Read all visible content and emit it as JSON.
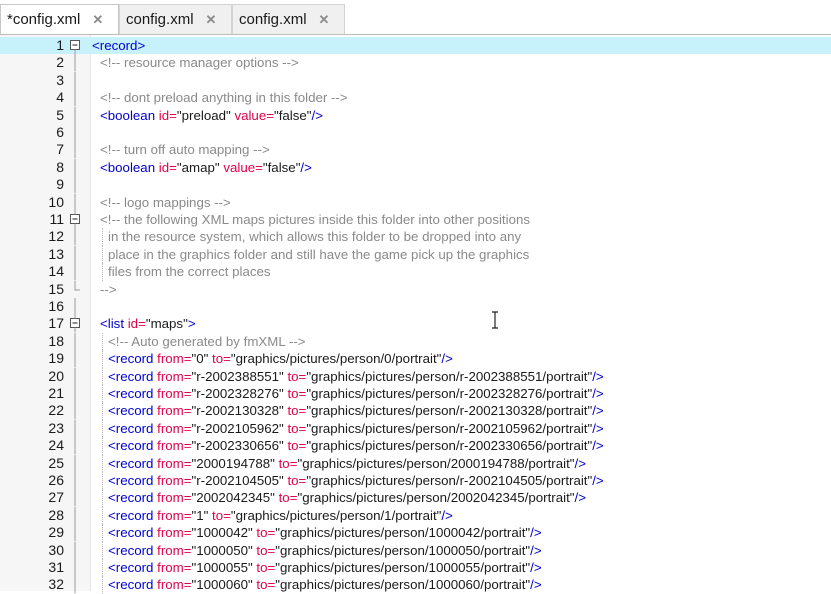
{
  "tabs": [
    {
      "label": "*config.xml",
      "active": true
    },
    {
      "label": "config.xml",
      "active": false
    },
    {
      "label": "config.xml",
      "active": false
    }
  ],
  "editor": {
    "current_line": 1,
    "lines": [
      {
        "n": "1",
        "indent": 0,
        "fold": "box",
        "parts": [
          {
            "t": "<record>",
            "c": "tg"
          }
        ]
      },
      {
        "n": "2",
        "indent": 1,
        "fold": "bar",
        "parts": [
          {
            "t": "<!-- resource manager options -->",
            "c": "cm"
          }
        ]
      },
      {
        "n": "3",
        "indent": 0,
        "fold": "bar",
        "parts": []
      },
      {
        "n": "4",
        "indent": 1,
        "fold": "bar",
        "parts": [
          {
            "t": "<!-- dont preload anything in this folder -->",
            "c": "cm"
          }
        ]
      },
      {
        "n": "5",
        "indent": 1,
        "fold": "bar",
        "parts": [
          {
            "t": "<boolean ",
            "c": "tg"
          },
          {
            "t": "id=",
            "c": "at"
          },
          {
            "t": "\"",
            "c": "tx"
          },
          {
            "t": "preload",
            "c": "tx"
          },
          {
            "t": "\" ",
            "c": "tx"
          },
          {
            "t": "value=",
            "c": "at"
          },
          {
            "t": "\"false\"",
            "c": "tx"
          },
          {
            "t": "/>",
            "c": "tg"
          }
        ]
      },
      {
        "n": "6",
        "indent": 0,
        "fold": "bar",
        "parts": []
      },
      {
        "n": "7",
        "indent": 1,
        "fold": "bar",
        "parts": [
          {
            "t": "<!-- turn off auto mapping -->",
            "c": "cm"
          }
        ]
      },
      {
        "n": "8",
        "indent": 1,
        "fold": "bar",
        "parts": [
          {
            "t": "<boolean ",
            "c": "tg"
          },
          {
            "t": "id=",
            "c": "at"
          },
          {
            "t": "\"amap\" ",
            "c": "tx"
          },
          {
            "t": "value=",
            "c": "at"
          },
          {
            "t": "\"false\"",
            "c": "tx"
          },
          {
            "t": "/>",
            "c": "tg"
          }
        ]
      },
      {
        "n": "9",
        "indent": 0,
        "fold": "bar",
        "parts": []
      },
      {
        "n": "10",
        "indent": 1,
        "fold": "bar",
        "parts": [
          {
            "t": "<!-- logo mappings -->",
            "c": "cm"
          }
        ]
      },
      {
        "n": "11",
        "indent": 1,
        "fold": "box",
        "parts": [
          {
            "t": "<!-- the following XML maps pictures inside this folder into other positions",
            "c": "cm"
          }
        ]
      },
      {
        "n": "12",
        "indent": 2,
        "fold": "bar",
        "parts": [
          {
            "t": "in the resource system, which allows this folder to be dropped into any",
            "c": "cm"
          }
        ]
      },
      {
        "n": "13",
        "indent": 2,
        "fold": "bar",
        "parts": [
          {
            "t": "place in the graphics folder and still have the game pick up the graphics",
            "c": "cm"
          }
        ]
      },
      {
        "n": "14",
        "indent": 2,
        "fold": "bar",
        "parts": [
          {
            "t": "files from the correct places",
            "c": "cm"
          }
        ]
      },
      {
        "n": "15",
        "indent": 1,
        "fold": "end",
        "parts": [
          {
            "t": "-->",
            "c": "cm"
          }
        ]
      },
      {
        "n": "16",
        "indent": 0,
        "fold": "bar",
        "parts": []
      },
      {
        "n": "17",
        "indent": 1,
        "fold": "box",
        "parts": [
          {
            "t": "<list ",
            "c": "tg"
          },
          {
            "t": "id=",
            "c": "at"
          },
          {
            "t": "\"maps\"",
            "c": "tx"
          },
          {
            "t": ">",
            "c": "tg"
          }
        ]
      },
      {
        "n": "18",
        "indent": 2,
        "fold": "bar",
        "parts": [
          {
            "t": "<!-- Auto generated by fmXML -->",
            "c": "cm"
          }
        ]
      },
      {
        "n": "19",
        "indent": 2,
        "fold": "bar",
        "parts": [
          {
            "t": "<record ",
            "c": "tg"
          },
          {
            "t": "from=",
            "c": "at"
          },
          {
            "t": "\"0\" ",
            "c": "tx"
          },
          {
            "t": "to=",
            "c": "at"
          },
          {
            "t": "\"graphics/pictures/person/0/portrait\"",
            "c": "tx"
          },
          {
            "t": "/>",
            "c": "tg"
          }
        ]
      },
      {
        "n": "20",
        "indent": 2,
        "fold": "bar",
        "parts": [
          {
            "t": "<record ",
            "c": "tg"
          },
          {
            "t": "from=",
            "c": "at"
          },
          {
            "t": "\"r-2002388551\" ",
            "c": "tx"
          },
          {
            "t": "to=",
            "c": "at"
          },
          {
            "t": "\"graphics/pictures/person/r-2002388551/portrait\"",
            "c": "tx"
          },
          {
            "t": "/>",
            "c": "tg"
          }
        ]
      },
      {
        "n": "21",
        "indent": 2,
        "fold": "bar",
        "parts": [
          {
            "t": "<record ",
            "c": "tg"
          },
          {
            "t": "from=",
            "c": "at"
          },
          {
            "t": "\"r-2002328276\" ",
            "c": "tx"
          },
          {
            "t": "to=",
            "c": "at"
          },
          {
            "t": "\"graphics/pictures/person/r-2002328276/portrait\"",
            "c": "tx"
          },
          {
            "t": "/>",
            "c": "tg"
          }
        ]
      },
      {
        "n": "22",
        "indent": 2,
        "fold": "bar",
        "parts": [
          {
            "t": "<record ",
            "c": "tg"
          },
          {
            "t": "from=",
            "c": "at"
          },
          {
            "t": "\"r-2002130328\" ",
            "c": "tx"
          },
          {
            "t": "to=",
            "c": "at"
          },
          {
            "t": "\"graphics/pictures/person/r-2002130328/portrait\"",
            "c": "tx"
          },
          {
            "t": "/>",
            "c": "tg"
          }
        ]
      },
      {
        "n": "23",
        "indent": 2,
        "fold": "bar",
        "parts": [
          {
            "t": "<record ",
            "c": "tg"
          },
          {
            "t": "from=",
            "c": "at"
          },
          {
            "t": "\"r-2002105962\" ",
            "c": "tx"
          },
          {
            "t": "to=",
            "c": "at"
          },
          {
            "t": "\"graphics/pictures/person/r-2002105962/portrait\"",
            "c": "tx"
          },
          {
            "t": "/>",
            "c": "tg"
          }
        ]
      },
      {
        "n": "24",
        "indent": 2,
        "fold": "bar",
        "parts": [
          {
            "t": "<record ",
            "c": "tg"
          },
          {
            "t": "from=",
            "c": "at"
          },
          {
            "t": "\"r-2002330656\" ",
            "c": "tx"
          },
          {
            "t": "to=",
            "c": "at"
          },
          {
            "t": "\"graphics/pictures/person/r-2002330656/portrait\"",
            "c": "tx"
          },
          {
            "t": "/>",
            "c": "tg"
          }
        ]
      },
      {
        "n": "25",
        "indent": 2,
        "fold": "bar",
        "parts": [
          {
            "t": "<record ",
            "c": "tg"
          },
          {
            "t": "from=",
            "c": "at"
          },
          {
            "t": "\"2000194788\" ",
            "c": "tx"
          },
          {
            "t": "to=",
            "c": "at"
          },
          {
            "t": "\"graphics/pictures/person/2000194788/portrait\"",
            "c": "tx"
          },
          {
            "t": "/>",
            "c": "tg"
          }
        ]
      },
      {
        "n": "26",
        "indent": 2,
        "fold": "bar",
        "parts": [
          {
            "t": "<record ",
            "c": "tg"
          },
          {
            "t": "from=",
            "c": "at"
          },
          {
            "t": "\"r-2002104505\" ",
            "c": "tx"
          },
          {
            "t": "to=",
            "c": "at"
          },
          {
            "t": "\"graphics/pictures/person/r-2002104505/portrait\"",
            "c": "tx"
          },
          {
            "t": "/>",
            "c": "tg"
          }
        ]
      },
      {
        "n": "27",
        "indent": 2,
        "fold": "bar",
        "parts": [
          {
            "t": "<record ",
            "c": "tg"
          },
          {
            "t": "from=",
            "c": "at"
          },
          {
            "t": "\"2002042345\" ",
            "c": "tx"
          },
          {
            "t": "to=",
            "c": "at"
          },
          {
            "t": "\"graphics/pictures/person/2002042345/portrait\"",
            "c": "tx"
          },
          {
            "t": "/>",
            "c": "tg"
          }
        ]
      },
      {
        "n": "28",
        "indent": 2,
        "fold": "bar",
        "parts": [
          {
            "t": "<record ",
            "c": "tg"
          },
          {
            "t": "from=",
            "c": "at"
          },
          {
            "t": "\"1\" ",
            "c": "tx"
          },
          {
            "t": "to=",
            "c": "at"
          },
          {
            "t": "\"graphics/pictures/person/1/portrait\"",
            "c": "tx"
          },
          {
            "t": "/>",
            "c": "tg"
          }
        ]
      },
      {
        "n": "29",
        "indent": 2,
        "fold": "bar",
        "parts": [
          {
            "t": "<record ",
            "c": "tg"
          },
          {
            "t": "from=",
            "c": "at"
          },
          {
            "t": "\"1000042\" ",
            "c": "tx"
          },
          {
            "t": "to=",
            "c": "at"
          },
          {
            "t": "\"graphics/pictures/person/1000042/portrait\"",
            "c": "tx"
          },
          {
            "t": "/>",
            "c": "tg"
          }
        ]
      },
      {
        "n": "30",
        "indent": 2,
        "fold": "bar",
        "parts": [
          {
            "t": "<record ",
            "c": "tg"
          },
          {
            "t": "from=",
            "c": "at"
          },
          {
            "t": "\"1000050\" ",
            "c": "tx"
          },
          {
            "t": "to=",
            "c": "at"
          },
          {
            "t": "\"graphics/pictures/person/1000050/portrait\"",
            "c": "tx"
          },
          {
            "t": "/>",
            "c": "tg"
          }
        ]
      },
      {
        "n": "31",
        "indent": 2,
        "fold": "bar",
        "parts": [
          {
            "t": "<record ",
            "c": "tg"
          },
          {
            "t": "from=",
            "c": "at"
          },
          {
            "t": "\"1000055\" ",
            "c": "tx"
          },
          {
            "t": "to=",
            "c": "at"
          },
          {
            "t": "\"graphics/pictures/person/1000055/portrait\"",
            "c": "tx"
          },
          {
            "t": "/>",
            "c": "tg"
          }
        ]
      },
      {
        "n": "32",
        "indent": 2,
        "fold": "bar",
        "parts": [
          {
            "t": "<record ",
            "c": "tg"
          },
          {
            "t": "from=",
            "c": "at"
          },
          {
            "t": "\"1000060\" ",
            "c": "tx"
          },
          {
            "t": "to=",
            "c": "at"
          },
          {
            "t": "\"graphics/pictures/person/1000060/portrait\"",
            "c": "tx"
          },
          {
            "t": "/>",
            "c": "tg"
          }
        ]
      }
    ]
  }
}
